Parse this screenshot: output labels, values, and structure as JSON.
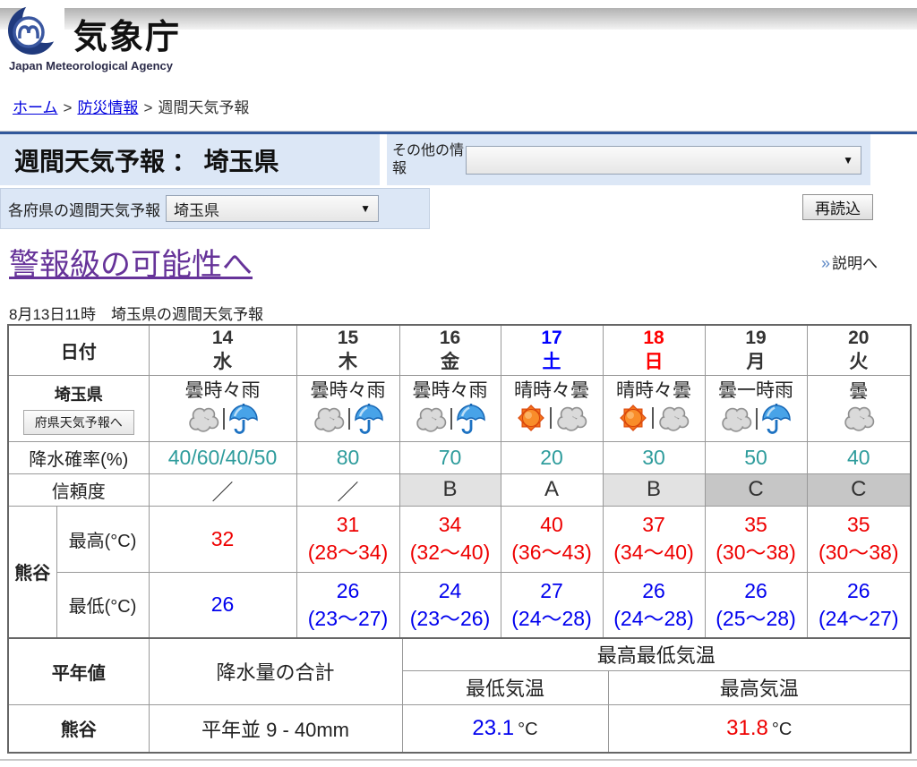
{
  "header": {
    "logo_title": "気象庁",
    "logo_subtitle": "Japan Meteorological Agency",
    "breadcrumb": [
      "ホーム",
      "防災情報",
      "週間天気予報"
    ]
  },
  "titlebar": {
    "title": "週間天気予報 ： 埼玉県",
    "other_info_label": "その他の情報",
    "other_info_value": "",
    "pref_select_label": "各府県の週間天気予報",
    "pref_select_value": "埼玉県",
    "reload_button": "再読込"
  },
  "links": {
    "warning_link": "警報級の可能性へ",
    "explain_link": "説明へ",
    "explain_icon": "double-chevron-right"
  },
  "issued": "8月13日11時　埼玉県の週間天気予報",
  "forecast_table": {
    "date_label": "日付",
    "area_label": "埼玉県",
    "area_button": "府県天気予報へ",
    "precip_label": "降水確率(%)",
    "reliability_label": "信頼度",
    "city_label": "熊谷",
    "max_label": "最高(°C)",
    "min_label": "最低(°C)",
    "days": [
      {
        "date": "14",
        "dow": "水",
        "color": "#333333",
        "weather": "曇時々雨",
        "icons": [
          "cloud",
          "umbrella"
        ],
        "precip": "40/60/40/50",
        "reliability": "／",
        "rel_bg": "#ffffff",
        "max": "32",
        "max_range": "",
        "min": "26",
        "min_range": ""
      },
      {
        "date": "15",
        "dow": "木",
        "color": "#333333",
        "weather": "曇時々雨",
        "icons": [
          "cloud",
          "umbrella"
        ],
        "precip": "80",
        "reliability": "／",
        "rel_bg": "#ffffff",
        "max": "31",
        "max_range": "(28～34)",
        "min": "26",
        "min_range": "(23～27)"
      },
      {
        "date": "16",
        "dow": "金",
        "color": "#333333",
        "weather": "曇時々雨",
        "icons": [
          "cloud",
          "umbrella"
        ],
        "precip": "70",
        "reliability": "B",
        "rel_bg": "#e2e2e2",
        "max": "34",
        "max_range": "(32～40)",
        "min": "24",
        "min_range": "(23～26)"
      },
      {
        "date": "17",
        "dow": "土",
        "color": "#0000ff",
        "weather": "晴時々曇",
        "icons": [
          "sun",
          "cloud"
        ],
        "precip": "20",
        "reliability": "A",
        "rel_bg": "#ffffff",
        "max": "40",
        "max_range": "(36～43)",
        "min": "27",
        "min_range": "(24～28)"
      },
      {
        "date": "18",
        "dow": "日",
        "color": "#ff0000",
        "weather": "晴時々曇",
        "icons": [
          "sun",
          "cloud"
        ],
        "precip": "30",
        "reliability": "B",
        "rel_bg": "#e2e2e2",
        "max": "37",
        "max_range": "(34～40)",
        "min": "26",
        "min_range": "(24～28)"
      },
      {
        "date": "19",
        "dow": "月",
        "color": "#333333",
        "weather": "曇一時雨",
        "icons": [
          "cloud",
          "umbrella"
        ],
        "precip": "50",
        "reliability": "C",
        "rel_bg": "#c6c6c6",
        "max": "35",
        "max_range": "(30～38)",
        "min": "26",
        "min_range": "(25～28)"
      },
      {
        "date": "20",
        "dow": "火",
        "color": "#333333",
        "weather": "曇",
        "icons": [
          "cloud"
        ],
        "precip": "40",
        "reliability": "C",
        "rel_bg": "#c6c6c6",
        "max": "35",
        "max_range": "(30～38)",
        "min": "26",
        "min_range": "(24～27)"
      }
    ]
  },
  "normals_table": {
    "header_label": "平年値",
    "precip_sum_label": "降水量の合計",
    "temp_header": "最高最低気温",
    "min_temp_label": "最低気温",
    "max_temp_label": "最高気温",
    "city_label": "熊谷",
    "precip_normal": "平年並 9 - 40mm",
    "min_temp_value": "23.1",
    "max_temp_value": "31.8",
    "temp_unit": "°C"
  },
  "colors": {
    "accent_band": "#dce7f6",
    "navy_border": "#31589b",
    "precip_text": "#2e9c9c",
    "max_temp_text": "#ee0000",
    "min_temp_text": "#0000ee",
    "visited_link": "#663399",
    "link": "#0000dd"
  }
}
